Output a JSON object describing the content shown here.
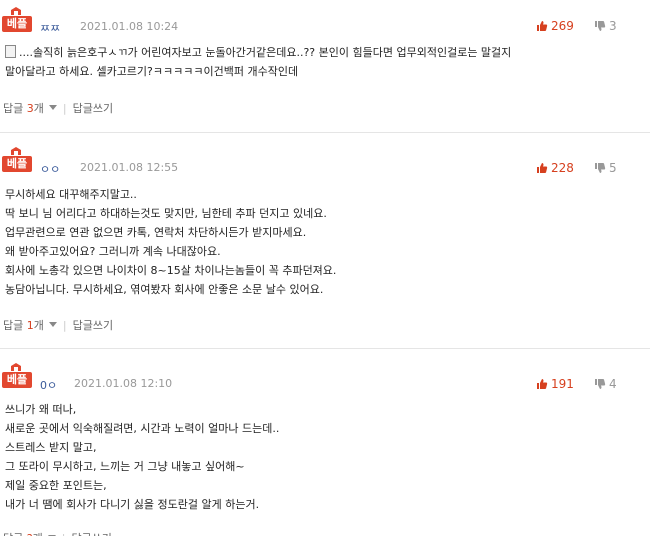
{
  "badge_label": "베플",
  "reply_label": "답글",
  "write_reply_label": "답글쓰기",
  "count_suffix": "개",
  "comments": [
    {
      "author": "ㅉㅉ",
      "date": "2021.01.08 10:24",
      "likes": "269",
      "dislikes": "3",
      "lines": [
        "....솔직히 늙은호구ㅅㄲ가 어린여자보고 눈돌아간거같은데요..?? 본인이 힘들다면 업무외적인걸로는 말걸지",
        "말아달라고 하세요. 셀카고르기?ㅋㅋㅋㅋㅋ이건백퍼 개수작인데"
      ],
      "reply_count": "3"
    },
    {
      "author": "ㅇㅇ",
      "date": "2021.01.08 12:55",
      "likes": "228",
      "dislikes": "5",
      "lines": [
        "무시하세요 대꾸해주지말고..",
        "딱 보니 님 어리다고 하대하는것도 맞지만, 님한테 추파 던지고 있네요.",
        "업무관련으로 연관 없으면 카톡, 연락처 차단하시든가 받지마세요.",
        "왜 받아주고있어요? 그러니까 계속 나대잖아요.",
        "회사에 노총각 있으면 나이차이 8~15살 차이나는놈들이 꼭 추파던져요.",
        "농담아닙니다. 무시하세요, 엮여봤자 회사에 안좋은 소문 날수 있어요."
      ],
      "reply_count": "1"
    },
    {
      "author": "0ㅇ",
      "date": "2021.01.08 12:10",
      "likes": "191",
      "dislikes": "4",
      "lines": [
        "쓰니가 왜 떠나,",
        "새로운 곳에서 익숙해질려면, 시간과 노력이 얼마나 드는데..",
        "스트레스 받지 말고,",
        "그 또라이 무시하고, 느끼는 거 그냥 내놓고 싶어해~",
        "제일 중요한 포인트는,",
        "내가 너 땜에 회사가 다니기 싫을 정도란걸 알게 하는거."
      ],
      "reply_count": "?"
    }
  ],
  "colors": {
    "badge": "#e2472f",
    "likes": "#d6401f",
    "author": "#3a5a9a"
  },
  "icons": [
    "thumbs-up-icon",
    "thumbs-down-icon",
    "memo-icon",
    "dropdown-triangle-icon"
  ]
}
